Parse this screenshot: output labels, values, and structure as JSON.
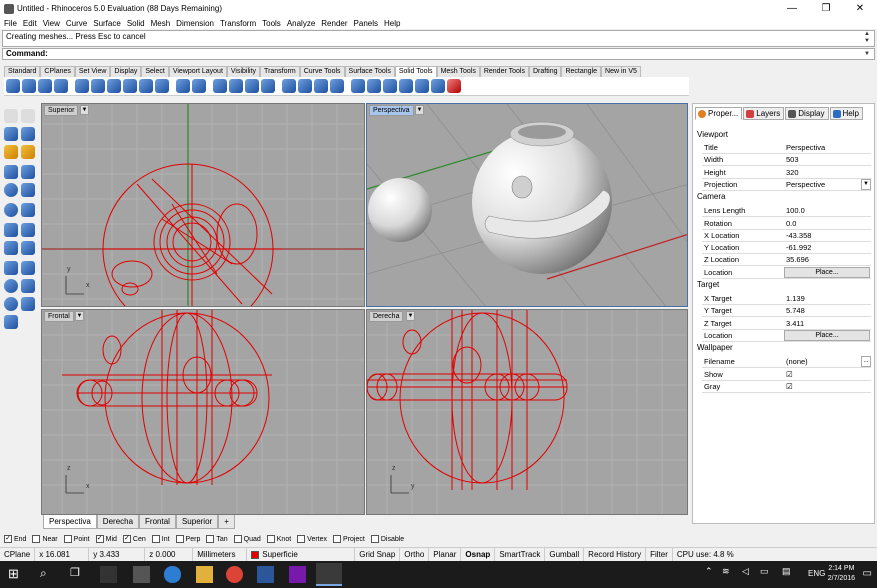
{
  "window": {
    "title": "Untitled - Rhinoceros 5.0 Evaluation (88 Days Remaining)",
    "min": "—",
    "max": "❐",
    "close": "✕"
  },
  "menu": [
    "File",
    "Edit",
    "View",
    "Curve",
    "Surface",
    "Solid",
    "Mesh",
    "Dimension",
    "Transform",
    "Tools",
    "Analyze",
    "Render",
    "Panels",
    "Help"
  ],
  "command": {
    "history": "Creating meshes... Press Esc to cancel",
    "prompt": "Command:"
  },
  "toolbar_tabs": [
    "Standard",
    "CPlanes",
    "Set View",
    "Display",
    "Select",
    "Viewport Layout",
    "Visibility",
    "Transform",
    "Curve Tools",
    "Surface Tools",
    "Solid Tools",
    "Mesh Tools",
    "Render Tools",
    "Drafting",
    "Rectangle",
    "New in V5"
  ],
  "active_toolbar_tab": "Solid Tools",
  "viewports": {
    "top_left": "Superior",
    "top_right": "Perspectiva",
    "bottom_left": "Frontal",
    "bottom_right": "Derecha"
  },
  "axis": {
    "x": "x",
    "y": "y",
    "z": "z"
  },
  "viewport_tabs": [
    "Perspectiva",
    "Derecha",
    "Frontal",
    "Superior"
  ],
  "viewport_tab_add": "+",
  "osnaps": [
    {
      "label": "End",
      "checked": true
    },
    {
      "label": "Near",
      "checked": false
    },
    {
      "label": "Point",
      "checked": false
    },
    {
      "label": "Mid",
      "checked": true
    },
    {
      "label": "Cen",
      "checked": true
    },
    {
      "label": "Int",
      "checked": false
    },
    {
      "label": "Perp",
      "checked": false
    },
    {
      "label": "Tan",
      "checked": false
    },
    {
      "label": "Quad",
      "checked": false
    },
    {
      "label": "Knot",
      "checked": false
    },
    {
      "label": "Vertex",
      "checked": false
    },
    {
      "label": "Project",
      "checked": false
    },
    {
      "label": "Disable",
      "checked": false
    }
  ],
  "status": {
    "cplane": "CPlane",
    "x": "x 16.081",
    "y": "y 3.433",
    "z": "z 0.000",
    "units": "Millimeters",
    "layer": "Superficie",
    "layer_color": "#e00000",
    "toggles": [
      "Grid Snap",
      "Ortho",
      "Planar",
      "Osnap",
      "SmartTrack",
      "Gumball",
      "Record History",
      "Filter"
    ],
    "cpu": "CPU use: 4.8 %"
  },
  "panel": {
    "tabs": [
      "Proper...",
      "Layers",
      "Display",
      "Help"
    ],
    "viewport_section": "Viewport",
    "viewport_rows": [
      {
        "k": "Title",
        "v": "Perspectiva"
      },
      {
        "k": "Width",
        "v": "503"
      },
      {
        "k": "Height",
        "v": "320"
      },
      {
        "k": "Projection",
        "v": "Perspective"
      }
    ],
    "camera_section": "Camera",
    "camera_rows": [
      {
        "k": "Lens Length",
        "v": "100.0"
      },
      {
        "k": "Rotation",
        "v": "0.0"
      },
      {
        "k": "X Location",
        "v": "-43.358"
      },
      {
        "k": "Y Location",
        "v": "-61.992"
      },
      {
        "k": "Z Location",
        "v": "35.696"
      },
      {
        "k": "Location",
        "v": "Place..."
      }
    ],
    "target_section": "Target",
    "target_rows": [
      {
        "k": "X Target",
        "v": "1.139"
      },
      {
        "k": "Y Target",
        "v": "5.748"
      },
      {
        "k": "Z Target",
        "v": "3.411"
      },
      {
        "k": "Location",
        "v": "Place..."
      }
    ],
    "wallpaper_section": "Wallpaper",
    "wallpaper_rows": [
      {
        "k": "Filename",
        "v": "(none)"
      },
      {
        "k": "Show",
        "v": "☑"
      },
      {
        "k": "Gray",
        "v": "☑"
      }
    ],
    "browse": "..."
  },
  "taskbar": {
    "time": "2:14 PM",
    "date": "2/7/2016",
    "lang": "ENG"
  }
}
